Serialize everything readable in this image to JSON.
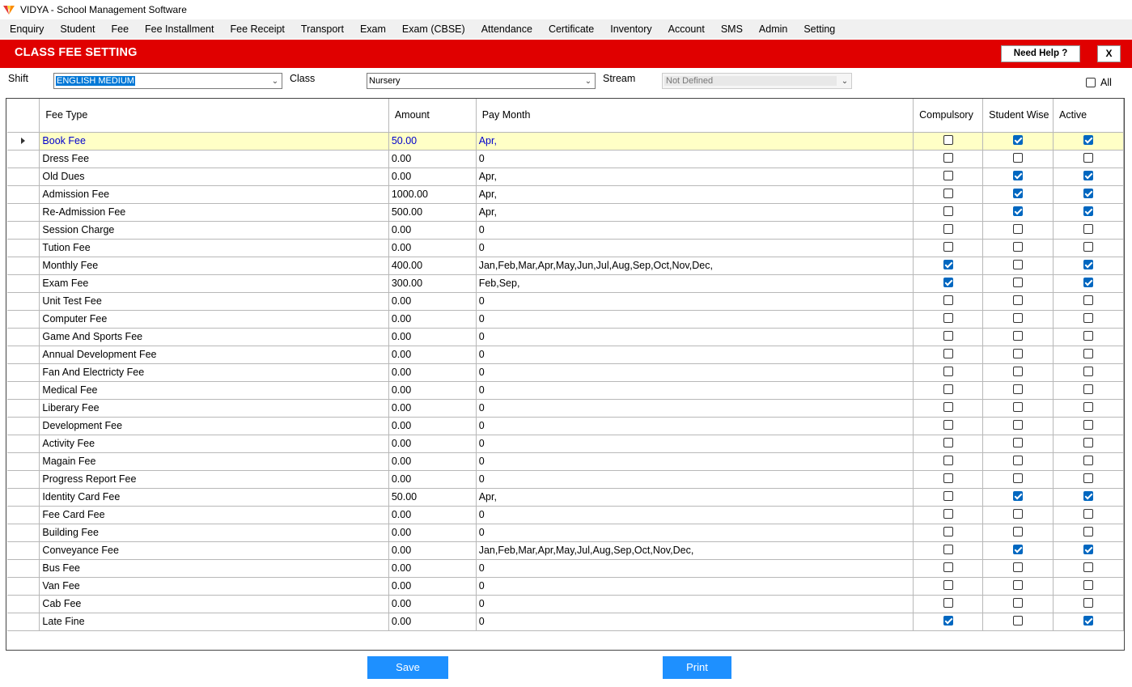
{
  "window": {
    "title": "VIDYA - School Management Software",
    "logo_icon": "vidya-logo-icon"
  },
  "menu": [
    "Enquiry",
    "Student",
    "Fee",
    "Fee Installment",
    "Fee Receipt",
    "Transport",
    "Exam",
    "Exam (CBSE)",
    "Attendance",
    "Certificate",
    "Inventory",
    "Account",
    "SMS",
    "Admin",
    "Setting"
  ],
  "header": {
    "title": "CLASS FEE SETTING",
    "help_label": "Need Help ?",
    "close_label": "X",
    "band_color": "#e00000"
  },
  "filters": {
    "shift_label": "Shift",
    "shift_value": "ENGLISH MEDIUM",
    "class_label": "Class",
    "class_value": "Nursery",
    "stream_label": "Stream",
    "stream_value": "Not Defined",
    "all_label": "All",
    "all_checked": false
  },
  "grid": {
    "columns": {
      "fee_type": "Fee Type",
      "amount": "Amount",
      "pay_month": "Pay Month",
      "compulsory": "Compulsory",
      "student_wise": "Student Wise",
      "active": "Active"
    },
    "rows": [
      {
        "fee_type": "Book Fee",
        "amount": "50.00",
        "pay_month": "Apr,",
        "compulsory": false,
        "student_wise": true,
        "active": true,
        "selected": true
      },
      {
        "fee_type": "Dress Fee",
        "amount": "0.00",
        "pay_month": "0",
        "compulsory": false,
        "student_wise": false,
        "active": false
      },
      {
        "fee_type": "Old Dues",
        "amount": "0.00",
        "pay_month": "Apr,",
        "compulsory": false,
        "student_wise": true,
        "active": true
      },
      {
        "fee_type": "Admission Fee",
        "amount": "1000.00",
        "pay_month": "Apr,",
        "compulsory": false,
        "student_wise": true,
        "active": true
      },
      {
        "fee_type": "Re-Admission Fee",
        "amount": "500.00",
        "pay_month": "Apr,",
        "compulsory": false,
        "student_wise": true,
        "active": true
      },
      {
        "fee_type": "Session Charge",
        "amount": "0.00",
        "pay_month": "0",
        "compulsory": false,
        "student_wise": false,
        "active": false
      },
      {
        "fee_type": "Tution Fee",
        "amount": "0.00",
        "pay_month": "0",
        "compulsory": false,
        "student_wise": false,
        "active": false
      },
      {
        "fee_type": "Monthly Fee",
        "amount": "400.00",
        "pay_month": "Jan,Feb,Mar,Apr,May,Jun,Jul,Aug,Sep,Oct,Nov,Dec,",
        "compulsory": true,
        "student_wise": false,
        "active": true
      },
      {
        "fee_type": "Exam Fee",
        "amount": "300.00",
        "pay_month": "Feb,Sep,",
        "compulsory": true,
        "student_wise": false,
        "active": true
      },
      {
        "fee_type": "Unit Test Fee",
        "amount": "0.00",
        "pay_month": "0",
        "compulsory": false,
        "student_wise": false,
        "active": false
      },
      {
        "fee_type": "Computer Fee",
        "amount": "0.00",
        "pay_month": "0",
        "compulsory": false,
        "student_wise": false,
        "active": false
      },
      {
        "fee_type": "Game And Sports Fee",
        "amount": "0.00",
        "pay_month": "0",
        "compulsory": false,
        "student_wise": false,
        "active": false
      },
      {
        "fee_type": "Annual Development Fee",
        "amount": "0.00",
        "pay_month": "0",
        "compulsory": false,
        "student_wise": false,
        "active": false
      },
      {
        "fee_type": "Fan And Electricty Fee",
        "amount": "0.00",
        "pay_month": "0",
        "compulsory": false,
        "student_wise": false,
        "active": false
      },
      {
        "fee_type": "Medical Fee",
        "amount": "0.00",
        "pay_month": "0",
        "compulsory": false,
        "student_wise": false,
        "active": false
      },
      {
        "fee_type": "Liberary Fee",
        "amount": "0.00",
        "pay_month": "0",
        "compulsory": false,
        "student_wise": false,
        "active": false
      },
      {
        "fee_type": "Development Fee",
        "amount": "0.00",
        "pay_month": "0",
        "compulsory": false,
        "student_wise": false,
        "active": false
      },
      {
        "fee_type": "Activity Fee",
        "amount": "0.00",
        "pay_month": "0",
        "compulsory": false,
        "student_wise": false,
        "active": false
      },
      {
        "fee_type": "Magain Fee",
        "amount": "0.00",
        "pay_month": "0",
        "compulsory": false,
        "student_wise": false,
        "active": false
      },
      {
        "fee_type": "Progress Report Fee",
        "amount": "0.00",
        "pay_month": "0",
        "compulsory": false,
        "student_wise": false,
        "active": false
      },
      {
        "fee_type": "Identity Card Fee",
        "amount": "50.00",
        "pay_month": "Apr,",
        "compulsory": false,
        "student_wise": true,
        "active": true
      },
      {
        "fee_type": "Fee Card Fee",
        "amount": "0.00",
        "pay_month": "0",
        "compulsory": false,
        "student_wise": false,
        "active": false
      },
      {
        "fee_type": "Building Fee",
        "amount": "0.00",
        "pay_month": "0",
        "compulsory": false,
        "student_wise": false,
        "active": false
      },
      {
        "fee_type": "Conveyance Fee",
        "amount": "0.00",
        "pay_month": "Jan,Feb,Mar,Apr,May,Jul,Aug,Sep,Oct,Nov,Dec,",
        "compulsory": false,
        "student_wise": true,
        "active": true
      },
      {
        "fee_type": "Bus Fee",
        "amount": "0.00",
        "pay_month": "0",
        "compulsory": false,
        "student_wise": false,
        "active": false
      },
      {
        "fee_type": "Van Fee",
        "amount": "0.00",
        "pay_month": "0",
        "compulsory": false,
        "student_wise": false,
        "active": false
      },
      {
        "fee_type": "Cab Fee",
        "amount": "0.00",
        "pay_month": "0",
        "compulsory": false,
        "student_wise": false,
        "active": false
      },
      {
        "fee_type": "Late Fine",
        "amount": "0.00",
        "pay_month": "0",
        "compulsory": true,
        "student_wise": false,
        "active": true
      }
    ]
  },
  "actions": {
    "save_label": "Save",
    "print_label": "Print",
    "button_color": "#1e90ff"
  },
  "colors": {
    "checkbox_checked": "#0067c0",
    "selected_row": "#ffffc6",
    "selected_text": "#0000cc"
  }
}
